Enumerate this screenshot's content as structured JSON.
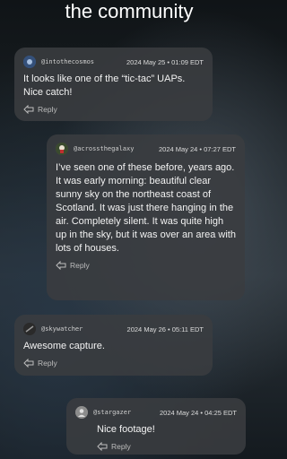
{
  "header": {
    "title": "the community"
  },
  "comments": [
    {
      "username": "@intothecosmos",
      "date": "2024 May 25 • 01:09 EDT",
      "text": "It looks like one of the “tic-tac” UAPs.  Nice catch!",
      "reply_label": "Reply"
    },
    {
      "username": "@acrossthegalaxy",
      "date": "2024 May 24 • 07:27 EDT",
      "text": "I’ve seen one of these before, years ago. It was early morning: beautiful clear sunny sky on the northeast coast of Scotland. It was just there hanging in the air. Completely silent. It was quite high up in the sky, but it was over an area with lots of houses.",
      "reply_label": "Reply"
    },
    {
      "username": "@skywatcher",
      "date": "2024 May 26 • 05:11 EDT",
      "text": "Awesome capture.",
      "reply_label": "Reply"
    },
    {
      "username": "@stargazer",
      "date": "2024 May 24 • 04:25 EDT",
      "text": "Nice footage!",
      "reply_label": "Reply"
    }
  ],
  "colors": {
    "card_bg": "#3a3c40",
    "text": "#f2f2f2",
    "muted": "#bdbdbd"
  }
}
